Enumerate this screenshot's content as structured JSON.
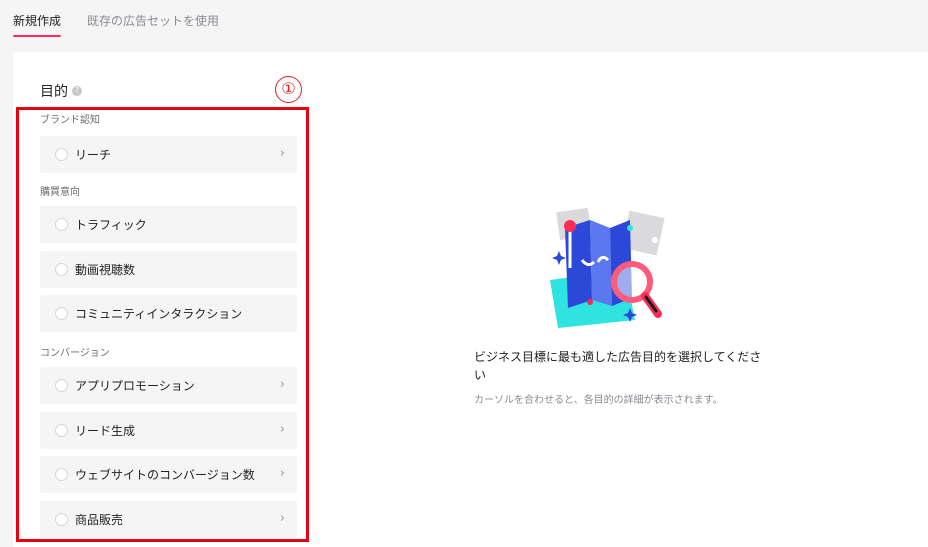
{
  "tabs": {
    "new_label": "新規作成",
    "existing_label": "既存の広告セットを使用"
  },
  "objective": {
    "title": "目的",
    "help_icon": "question-circle-icon",
    "marker": "①",
    "groups": [
      {
        "label": "ブランド認知",
        "items": [
          {
            "label": "リーチ",
            "chevron": true
          }
        ]
      },
      {
        "label": "購買意向",
        "items": [
          {
            "label": "トラフィック",
            "chevron": false
          },
          {
            "label": "動画視聴数",
            "chevron": false
          },
          {
            "label": "コミュニティインタラクション",
            "chevron": false
          }
        ]
      },
      {
        "label": "コンバージョン",
        "items": [
          {
            "label": "アプリプロモーション",
            "chevron": true
          },
          {
            "label": "リード生成",
            "chevron": true
          },
          {
            "label": "ウェブサイトのコンバージョン数",
            "chevron": true
          },
          {
            "label": "商品販売",
            "chevron": true
          }
        ]
      }
    ]
  },
  "colors": {
    "accent": "#fe2c55",
    "highlight_box": "#e60012"
  },
  "info": {
    "illustration": "map-magnifier-illustration",
    "title": "ビジネス目標に最も適した広告目的を選択してください",
    "subtitle": "カーソルを合わせると、各目的の詳細が表示されます。"
  }
}
